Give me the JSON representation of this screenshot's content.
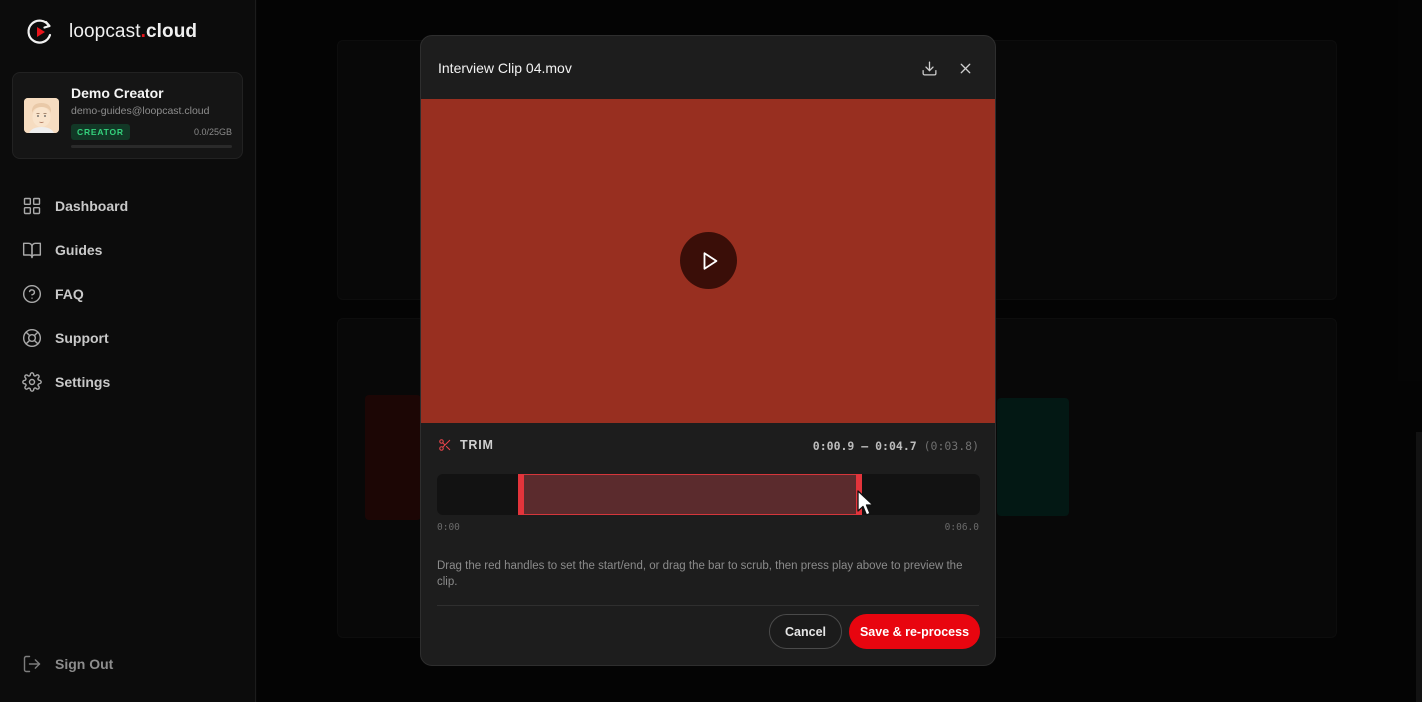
{
  "brand": {
    "name_part": "loopcast",
    "dot": ".",
    "tld": "cloud",
    "logo_icon": "loop-play-icon"
  },
  "profile": {
    "name": "Demo Creator",
    "email": "demo-guides@loopcast.cloud",
    "badge": "CREATOR",
    "usage": "0.0/25GB",
    "usage_fraction": 0.0
  },
  "nav": {
    "items": [
      {
        "label": "Dashboard",
        "icon": "grid-icon"
      },
      {
        "label": "Guides",
        "icon": "book-icon"
      },
      {
        "label": "FAQ",
        "icon": "help-circle-icon"
      },
      {
        "label": "Support",
        "icon": "lifebuoy-icon"
      },
      {
        "label": "Settings",
        "icon": "gear-icon"
      }
    ],
    "sign_out": "Sign Out"
  },
  "modal": {
    "title": "Interview Clip 04.mov",
    "download_icon": "download-icon",
    "close_icon": "close-icon",
    "play_icon": "play-icon",
    "video_color": "#982f20",
    "trim": {
      "label": "TRIM",
      "range_start": "0:00.9",
      "separator": " – ",
      "range_end": "0:04.7",
      "duration": "(0:03.8)",
      "timeline_start": "0:00",
      "timeline_end": "0:06.0",
      "selection_start_seconds": 0.9,
      "selection_end_seconds": 4.7,
      "total_seconds": 6.0
    },
    "help_text": "Drag the red handles to set the start/end, or drag the bar to scrub, then press play above to preview the clip.",
    "cancel_label": "Cancel",
    "save_label": "Save & re-process"
  },
  "colors": {
    "accent": "#e8050f",
    "handle": "#e3343b",
    "badge_green": "#34d27c"
  }
}
